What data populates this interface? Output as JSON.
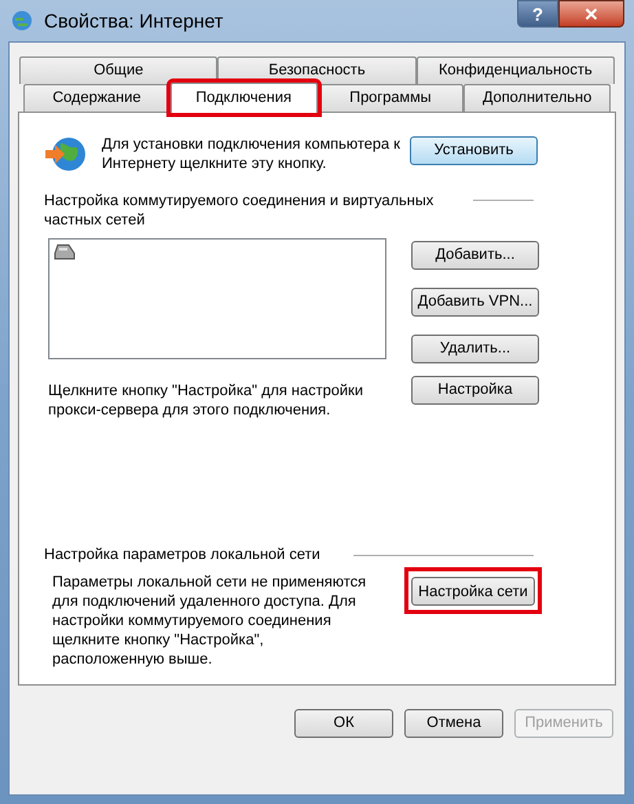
{
  "window": {
    "title": "Свойства: Интернет",
    "help": "?",
    "close": "✕"
  },
  "tab_rows": [
    [
      {
        "label": "Общие",
        "selected": false,
        "highlighted": false
      },
      {
        "label": "Безопасность",
        "selected": false,
        "highlighted": false
      },
      {
        "label": "Конфиденциальность",
        "selected": false,
        "highlighted": false
      }
    ],
    [
      {
        "label": "Содержание",
        "selected": false,
        "highlighted": false
      },
      {
        "label": "Подключения",
        "selected": true,
        "highlighted": true
      },
      {
        "label": "Программы",
        "selected": false,
        "highlighted": false
      },
      {
        "label": "Дополнительно",
        "selected": false,
        "highlighted": false
      }
    ]
  ],
  "setup": {
    "text": "Для установки подключения компьютера к Интернету щелкните эту кнопку.",
    "button": "Установить"
  },
  "dialup": {
    "heading": "Настройка коммутируемого соединения и виртуальных частных сетей",
    "buttons": [
      {
        "label": "Добавить...",
        "highlighted": false
      },
      {
        "label": "Добавить VPN...",
        "highlighted": false
      },
      {
        "label": "Удалить...",
        "highlighted": false
      }
    ],
    "proxy_text": "Щелкните кнопку \"Настройка\" для настройки прокси-сервера для этого подключения.",
    "settings_button": {
      "label": "Настройка",
      "highlighted": false
    }
  },
  "lan": {
    "heading": "Настройка параметров локальной сети",
    "text": "Параметры локальной сети не применяются для подключений удаленного доступа. Для настройки коммутируемого соединения щелкните кнопку \"Настройка\", расположенную выше.",
    "button": {
      "label": "Настройка сети",
      "highlighted": true
    }
  },
  "footer_buttons": [
    {
      "label": "ОК",
      "disabled": false
    },
    {
      "label": "Отмена",
      "disabled": false
    },
    {
      "label": "Применить",
      "disabled": true
    }
  ]
}
